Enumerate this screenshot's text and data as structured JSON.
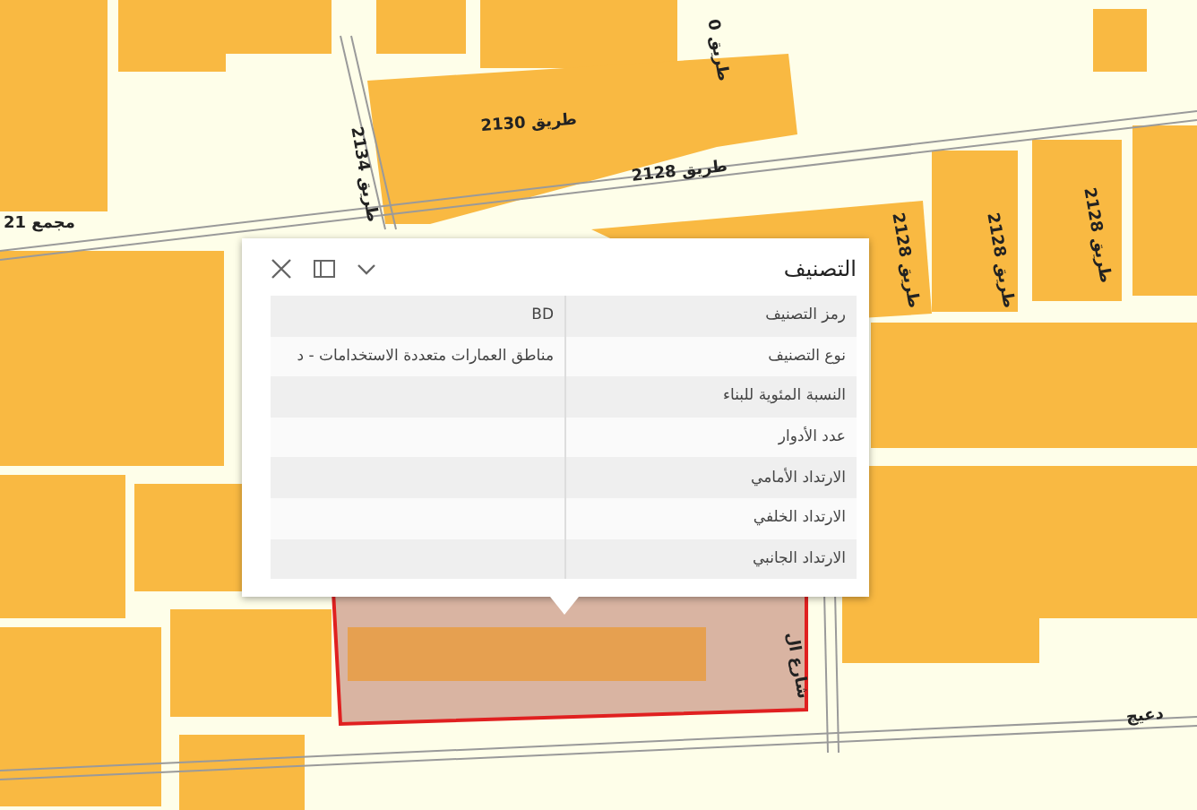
{
  "map": {
    "labels": [
      {
        "text": "طريق 2130"
      },
      {
        "text": "طريق 2134"
      },
      {
        "text": "طريق 2128"
      },
      {
        "text": "طريق 2128"
      },
      {
        "text": "طريق 2128"
      },
      {
        "text": "طريق 2128"
      },
      {
        "text": "طريق 0"
      },
      {
        "text": "مجمع 21"
      },
      {
        "text": "شارع ال"
      },
      {
        "text": "دعيج"
      }
    ]
  },
  "popup": {
    "title": "التصنيف",
    "rows": [
      {
        "label": "رمز التصنيف",
        "value": "BD"
      },
      {
        "label": "نوع التصنيف",
        "value": "مناطق العمارات متعددة الاستخدامات - د"
      },
      {
        "label": "النسبة المئوية للبناء"
      },
      {
        "label": "عدد الأدوار"
      },
      {
        "label": "الارتداد الأمامي"
      },
      {
        "label": "الارتداد الخلفي"
      },
      {
        "label": "الارتداد الجانبي"
      }
    ]
  }
}
